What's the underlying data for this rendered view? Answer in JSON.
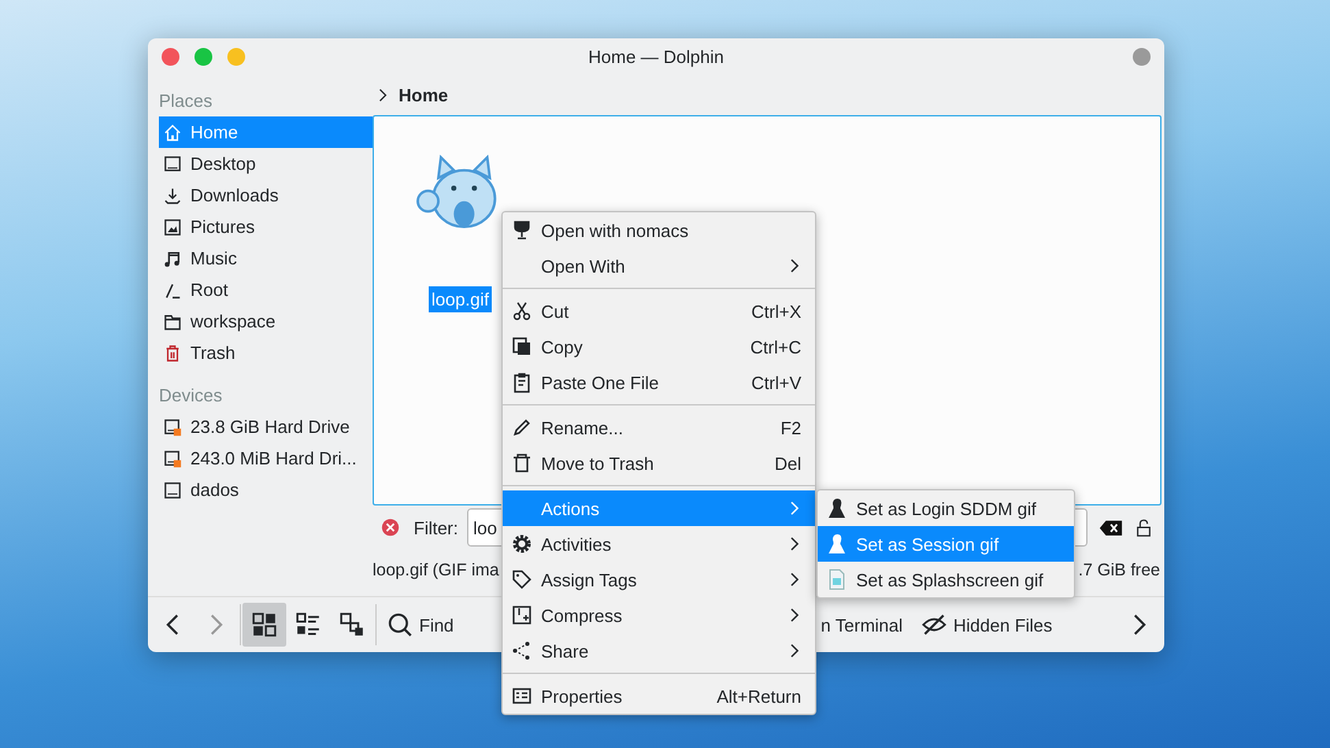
{
  "window": {
    "title": "Home — Dolphin"
  },
  "sidebar": {
    "sections": [
      {
        "heading": "Places",
        "items": [
          {
            "label": "Home",
            "selected": true
          },
          {
            "label": "Desktop",
            "selected": false
          },
          {
            "label": "Downloads",
            "selected": false
          },
          {
            "label": "Pictures",
            "selected": false
          },
          {
            "label": "Music",
            "selected": false
          },
          {
            "label": "Root",
            "selected": false
          },
          {
            "label": "workspace",
            "selected": false
          },
          {
            "label": "Trash",
            "selected": false
          }
        ]
      },
      {
        "heading": "Devices",
        "items": [
          {
            "label": "23.8 GiB Hard Drive",
            "selected": false
          },
          {
            "label": "243.0 MiB Hard Dri...",
            "selected": false
          },
          {
            "label": "dados",
            "selected": false
          }
        ]
      }
    ]
  },
  "breadcrumb": {
    "location": "Home"
  },
  "files": [
    {
      "name": "loop.gif",
      "selected": true
    }
  ],
  "filter_bar": {
    "label": "Filter:",
    "value": "loo"
  },
  "status_bar": {
    "info": "loop.gif (GIF ima",
    "free_space": ".7 GiB free"
  },
  "toolbar": {
    "view_modes": [
      {
        "selected": true
      },
      {
        "selected": false
      },
      {
        "selected": false
      }
    ],
    "buttons": [
      "Find",
      "n Terminal",
      "Hidden Files"
    ]
  },
  "context_menu": {
    "groups": [
      [
        {
          "label": "Open with nomacs",
          "submenu": false,
          "selected": false
        },
        {
          "label": "Open With",
          "submenu": true,
          "selected": false
        }
      ],
      [
        {
          "label": "Cut",
          "shortcut": "Ctrl+X",
          "submenu": false,
          "selected": false
        },
        {
          "label": "Copy",
          "shortcut": "Ctrl+C",
          "submenu": false,
          "selected": false
        },
        {
          "label": "Paste One File",
          "shortcut": "Ctrl+V",
          "submenu": false,
          "selected": false
        }
      ],
      [
        {
          "label": "Rename...",
          "shortcut": "F2",
          "submenu": false,
          "selected": false
        },
        {
          "label": "Move to Trash",
          "shortcut": "Del",
          "submenu": false,
          "selected": false
        }
      ],
      [
        {
          "label": "Actions",
          "submenu": true,
          "selected": true
        },
        {
          "label": "Activities",
          "submenu": true,
          "selected": false
        },
        {
          "label": "Assign Tags",
          "submenu": true,
          "selected": false
        },
        {
          "label": "Compress",
          "submenu": true,
          "selected": false
        },
        {
          "label": "Share",
          "submenu": true,
          "selected": false
        }
      ],
      [
        {
          "label": "Properties",
          "shortcut": "Alt+Return",
          "submenu": false,
          "selected": false
        }
      ]
    ]
  },
  "submenu": {
    "items": [
      {
        "label": "Set as Login SDDM gif",
        "selected": false
      },
      {
        "label": "Set as Session gif",
        "selected": true
      },
      {
        "label": "Set as Splashscreen gif",
        "selected": false
      }
    ]
  }
}
